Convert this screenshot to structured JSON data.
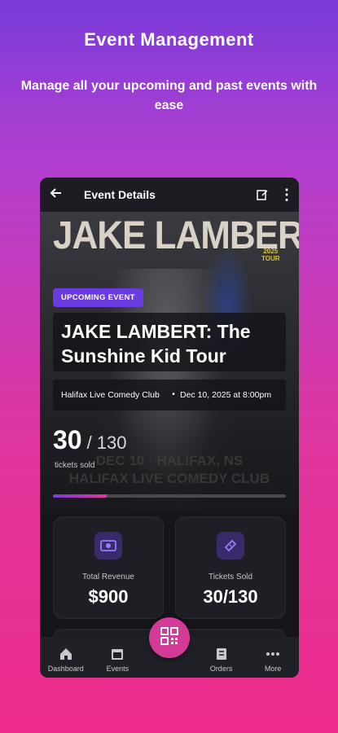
{
  "promo": {
    "headline": "Event Management",
    "subline": "Manage all your upcoming and past events with ease"
  },
  "appbar": {
    "title": "Event Details",
    "back_icon": "arrow-left-icon",
    "edit_icon": "edit-icon",
    "more_icon": "kebab-icon"
  },
  "poster": {
    "name": "JAKE LAMBERT",
    "year_tag_line1": "2025",
    "year_tag_line2": "TOUR",
    "caption_line1": "DEC 10 · HALIFAX, NS",
    "caption_line2": "HALIFAX LIVE COMEDY CLUB"
  },
  "event": {
    "status_badge": "UPCOMING EVENT",
    "title": "JAKE LAMBERT: The Sunshine Kid Tour",
    "venue": "Halifax Live Comedy Club",
    "separator": "•",
    "datetime": "Dec 10, 2025 at 8:00pm",
    "tickets_sold": "30",
    "tickets_separator": "/",
    "tickets_total": "130",
    "tickets_caption": "tickets sold",
    "progress_fraction": 0.23
  },
  "stats": [
    {
      "label": "Total Revenue",
      "value": "$900",
      "icon": "revenue-icon"
    },
    {
      "label": "Tickets Sold",
      "value": "30/130",
      "icon": "ticket-icon"
    }
  ],
  "nav": {
    "items": [
      {
        "label": "Dashboard",
        "icon": "home-icon"
      },
      {
        "label": "Events",
        "icon": "calendar-icon"
      },
      {
        "label": "Orders",
        "icon": "orders-icon"
      },
      {
        "label": "More",
        "icon": "more-dots-icon"
      }
    ],
    "fab_icon": "qr-code-icon"
  },
  "colors": {
    "accent": "#6a3be0",
    "fab": "#d43a98",
    "background_top": "#7a3bd9",
    "background_bottom": "#ee2c8c"
  }
}
